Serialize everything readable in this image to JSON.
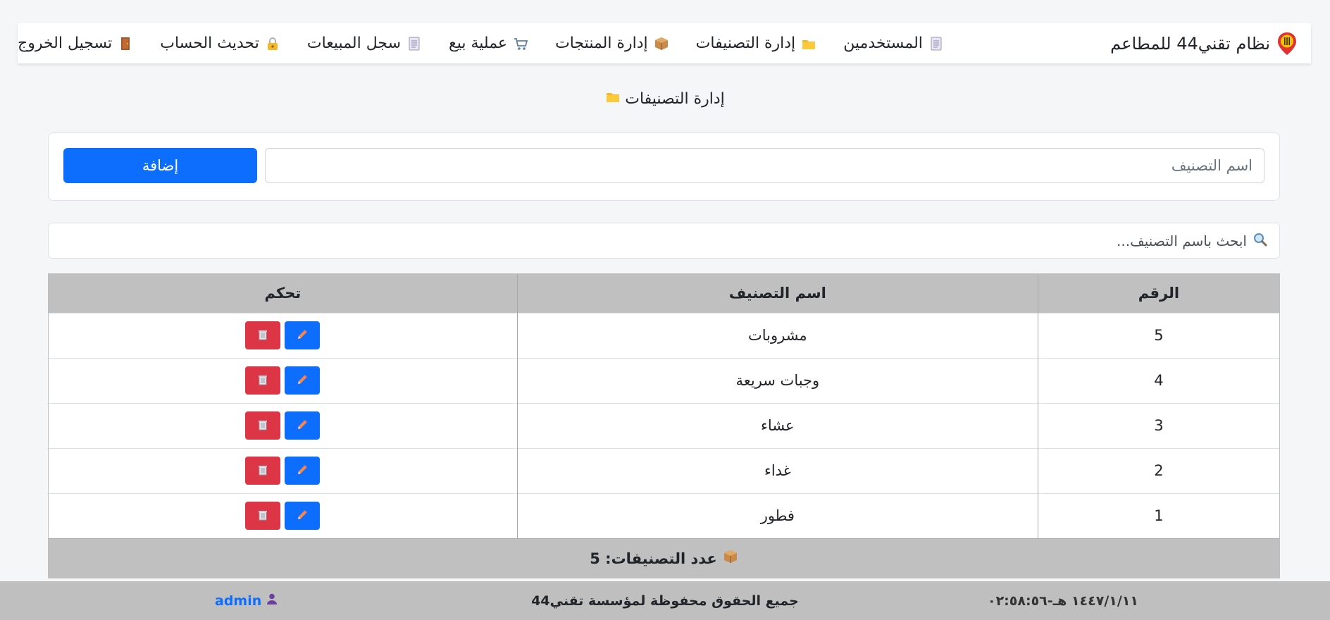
{
  "navbar": {
    "brand": "نظام تقني44 للمطاعم",
    "links": [
      {
        "label": "المستخدمين",
        "icon": "receipt-icon"
      },
      {
        "label": "إدارة التصنيفات",
        "icon": "folder-icon"
      },
      {
        "label": "إدارة المنتجات",
        "icon": "box-icon"
      },
      {
        "label": "عملية بيع",
        "icon": "cart-icon"
      },
      {
        "label": "سجل المبيعات",
        "icon": "receipt-icon"
      },
      {
        "label": "تحديث الحساب",
        "icon": "lock-icon"
      },
      {
        "label": "تسجيل الخروج",
        "icon": "door-icon"
      }
    ]
  },
  "page": {
    "title": "إدارة التصنيفات"
  },
  "add_form": {
    "placeholder": "اسم التصنيف",
    "button_label": "إضافة"
  },
  "search": {
    "placeholder": "ابحث باسم التصنيف..."
  },
  "table": {
    "headers": {
      "num": "الرقم",
      "name": "اسم التصنيف",
      "control": "تحكم"
    },
    "rows": [
      {
        "num": "5",
        "name": "مشروبات"
      },
      {
        "num": "4",
        "name": "وجبات سريعة"
      },
      {
        "num": "3",
        "name": "عشاء"
      },
      {
        "num": "2",
        "name": "غداء"
      },
      {
        "num": "1",
        "name": "فطور"
      }
    ],
    "footer_label": "عدد التصنيفات: 5"
  },
  "footer": {
    "datetime": "١٤٤٧/١/١١ هـ-٠٢:٥٨:٥٦",
    "rights": "جميع الحقوق محفوظة لمؤسسة تقني44",
    "user": "admin"
  },
  "colors": {
    "primary": "#0d6efd",
    "danger": "#dc3545",
    "header_gray": "#c0c0c0"
  }
}
